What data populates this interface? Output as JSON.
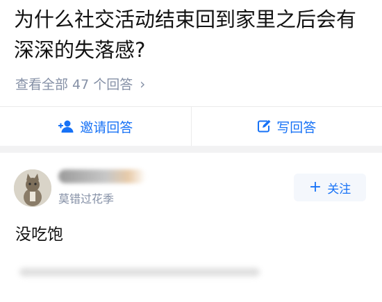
{
  "question": {
    "title": "为什么社交活动结束回到家里之后会有深深的失落感?",
    "view_all": "查看全部 47 个回答",
    "chevron": "›"
  },
  "actions": {
    "invite_label": "邀请回答",
    "write_label": "写回答"
  },
  "answer": {
    "author_bio": "莫错过花季",
    "follow_label": "关注",
    "follow_plus": "+",
    "content": "没吃饱"
  },
  "icons": {
    "invite": "add-person-icon",
    "write": "edit-icon",
    "follow": "plus-icon",
    "view_all": "chevron-right-icon"
  },
  "colors": {
    "accent": "#1772f6",
    "secondary_text": "#8590a6",
    "divider": "#ebebeb",
    "section_gap": "#f2f2f3"
  }
}
